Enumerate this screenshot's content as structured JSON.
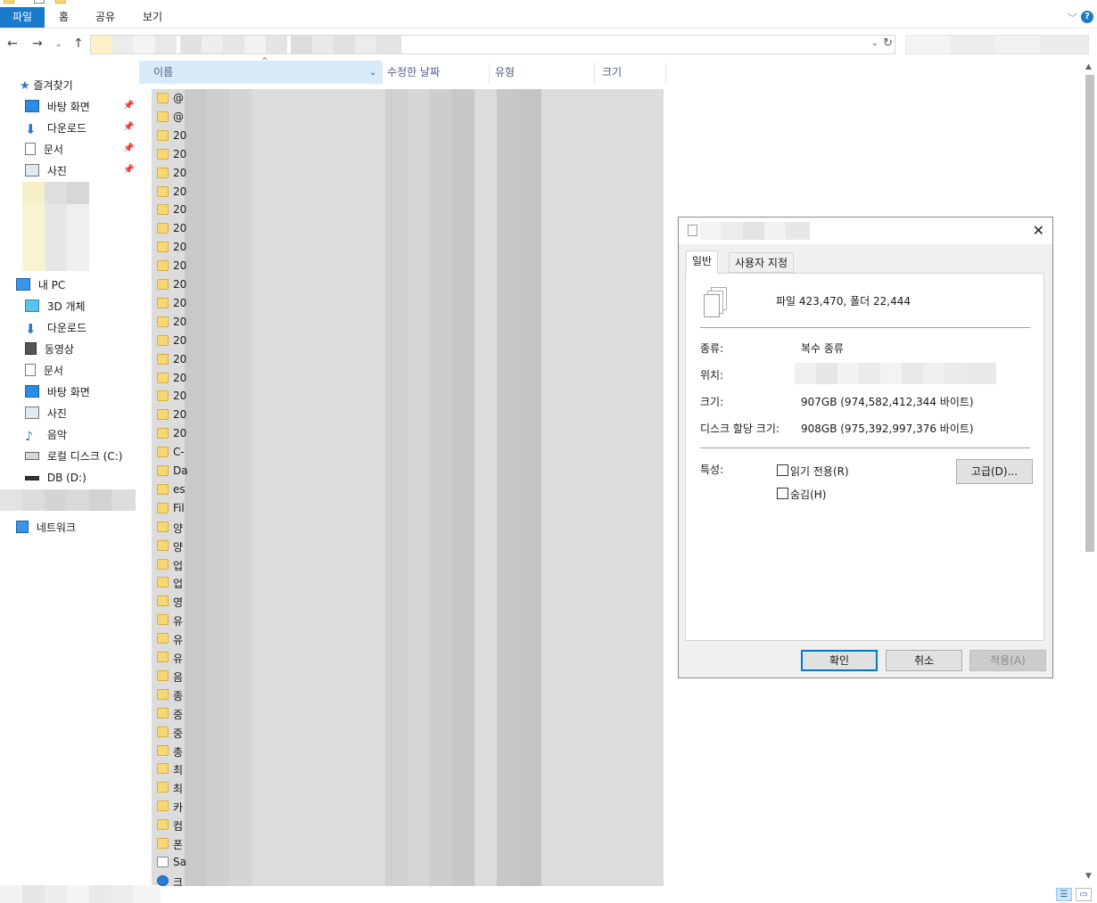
{
  "ribbon": {
    "tabs": [
      "파일",
      "홈",
      "공유",
      "보기"
    ],
    "help_glyph": "?"
  },
  "nav": {
    "quick_access": "즐겨찾기",
    "quick_items": [
      "바탕 화면",
      "다운로드",
      "문서",
      "사진"
    ],
    "this_pc": "내 PC",
    "pc_items": [
      "3D 개체",
      "다운로드",
      "동영상",
      "문서",
      "바탕 화면",
      "사진",
      "음악",
      "로컬 디스크 (C:)",
      "DB (D:)"
    ],
    "network": "네트워크"
  },
  "columns": {
    "name": "이름",
    "modified": "수정한 날짜",
    "type": "유형",
    "size": "크기"
  },
  "files": [
    {
      "name": "@",
      "icon": "folder"
    },
    {
      "name": "@",
      "icon": "folder"
    },
    {
      "name": "20",
      "icon": "folder"
    },
    {
      "name": "20",
      "icon": "folder"
    },
    {
      "name": "20",
      "icon": "folder"
    },
    {
      "name": "20",
      "icon": "folder"
    },
    {
      "name": "20",
      "icon": "folder"
    },
    {
      "name": "20",
      "icon": "folder"
    },
    {
      "name": "20",
      "icon": "folder"
    },
    {
      "name": "20",
      "icon": "folder"
    },
    {
      "name": "20",
      "icon": "folder"
    },
    {
      "name": "20",
      "icon": "folder"
    },
    {
      "name": "20",
      "icon": "folder"
    },
    {
      "name": "20",
      "icon": "folder"
    },
    {
      "name": "20",
      "icon": "folder"
    },
    {
      "name": "20",
      "icon": "folder"
    },
    {
      "name": "20",
      "icon": "folder"
    },
    {
      "name": "20",
      "icon": "folder"
    },
    {
      "name": "20",
      "icon": "folder"
    },
    {
      "name": "C-",
      "icon": "folder"
    },
    {
      "name": "Da",
      "icon": "folder"
    },
    {
      "name": "es",
      "icon": "folder"
    },
    {
      "name": "Fil",
      "icon": "folder"
    },
    {
      "name": "양",
      "icon": "folder"
    },
    {
      "name": "양",
      "icon": "folder"
    },
    {
      "name": "업",
      "icon": "folder"
    },
    {
      "name": "업",
      "icon": "folder"
    },
    {
      "name": "영",
      "icon": "folder"
    },
    {
      "name": "유",
      "icon": "folder"
    },
    {
      "name": "유",
      "icon": "folder"
    },
    {
      "name": "유",
      "icon": "folder"
    },
    {
      "name": "음",
      "icon": "folder"
    },
    {
      "name": "종",
      "icon": "folder"
    },
    {
      "name": "중",
      "icon": "folder"
    },
    {
      "name": "중",
      "icon": "folder"
    },
    {
      "name": "총",
      "icon": "folder"
    },
    {
      "name": "최",
      "icon": "folder"
    },
    {
      "name": "최",
      "icon": "folder"
    },
    {
      "name": "카",
      "icon": "folder"
    },
    {
      "name": "컴",
      "icon": "folder"
    },
    {
      "name": "폰",
      "icon": "folder"
    },
    {
      "name": "Sa",
      "icon": "document"
    },
    {
      "name": "크",
      "icon": "shortcut"
    }
  ],
  "dialog": {
    "tabs": [
      "일반",
      "사용자 지정"
    ],
    "summary": "파일 423,470, 폴더 22,444",
    "type_label": "종류:",
    "type_value": "복수 종류",
    "location_label": "위치:",
    "size_label": "크기:",
    "size_value": "907GB (974,582,412,344 바이트)",
    "disk_label": "디스크 할당 크기:",
    "disk_value": "908GB (975,392,997,376 바이트)",
    "attributes_label": "특성:",
    "readonly_label": "읽기 전용(R)",
    "hidden_label": "숨김(H)",
    "advanced_button": "고급(D)...",
    "ok_button": "확인",
    "cancel_button": "취소",
    "apply_button": "적용(A)",
    "close_glyph": "✕"
  }
}
